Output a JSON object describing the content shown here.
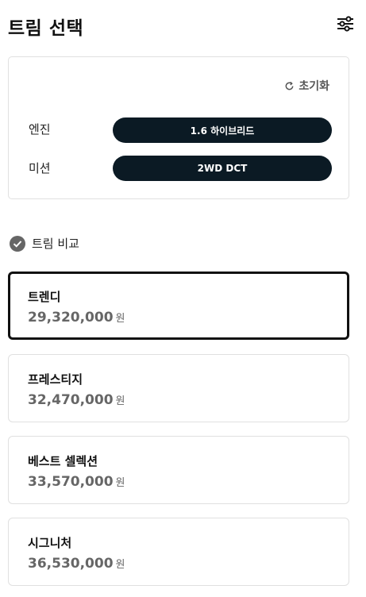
{
  "header": {
    "title": "트림 선택",
    "filter_icon": "sliders-icon"
  },
  "options": {
    "reset_label": "초기화",
    "rows": [
      {
        "label": "엔진",
        "value": "1.6 하이브리드"
      },
      {
        "label": "미션",
        "value": "2WD DCT"
      }
    ]
  },
  "compare": {
    "label": "트림 비교"
  },
  "trims": [
    {
      "name": "트렌디",
      "price": "29,320,000",
      "unit": "원",
      "selected": true
    },
    {
      "name": "프레스티지",
      "price": "32,470,000",
      "unit": "원",
      "selected": false
    },
    {
      "name": "베스트 셀렉션",
      "price": "33,570,000",
      "unit": "원",
      "selected": false
    },
    {
      "name": "시그니처",
      "price": "36,530,000",
      "unit": "원",
      "selected": false
    }
  ],
  "colors": {
    "pill_bg": "#0b1a24",
    "selected_border": "#111111",
    "price_text": "#666666"
  }
}
